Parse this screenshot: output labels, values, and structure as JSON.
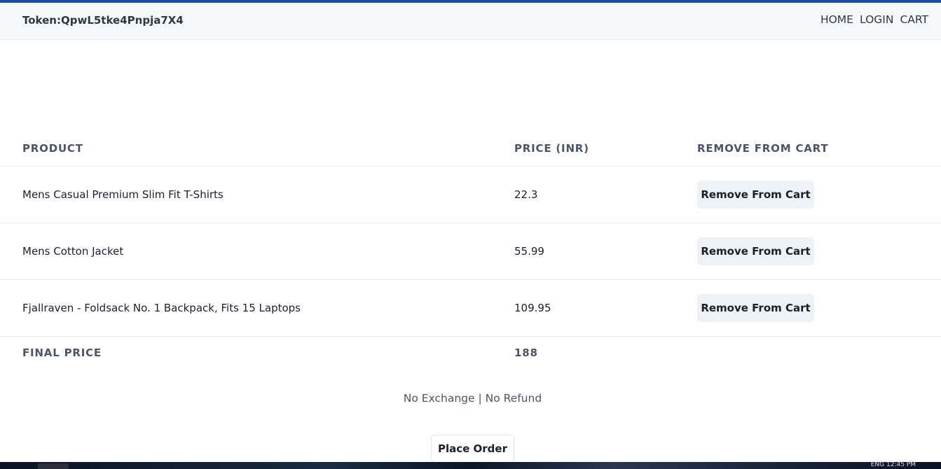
{
  "header": {
    "token_label": "Token:QpwL5tke4Pnpja7X4",
    "nav": [
      "HOME",
      "LOGIN",
      "CART"
    ]
  },
  "table": {
    "columns": [
      "PRODUCT",
      "PRICE (INR)",
      "REMOVE FROM CART"
    ],
    "rows": [
      {
        "product": "Mens Casual Premium Slim Fit T-Shirts",
        "price": "22.3",
        "action": "Remove From Cart"
      },
      {
        "product": "Mens Cotton Jacket",
        "price": "55.99",
        "action": "Remove From Cart"
      },
      {
        "product": "Fjallraven - Foldsack No. 1 Backpack, Fits 15 Laptops",
        "price": "109.95",
        "action": "Remove From Cart"
      }
    ],
    "footer": {
      "label": "FINAL PRICE",
      "value": "188"
    }
  },
  "policy": "No Exchange | No Refund",
  "place_order_label": "Place Order",
  "taskbar": {
    "tray_text": "ENG  12:45 PM"
  },
  "colors": {
    "accent_line": "#1e4fa0",
    "navbar_bg": "#f6f9fc",
    "button_bg": "#edf2f7"
  }
}
